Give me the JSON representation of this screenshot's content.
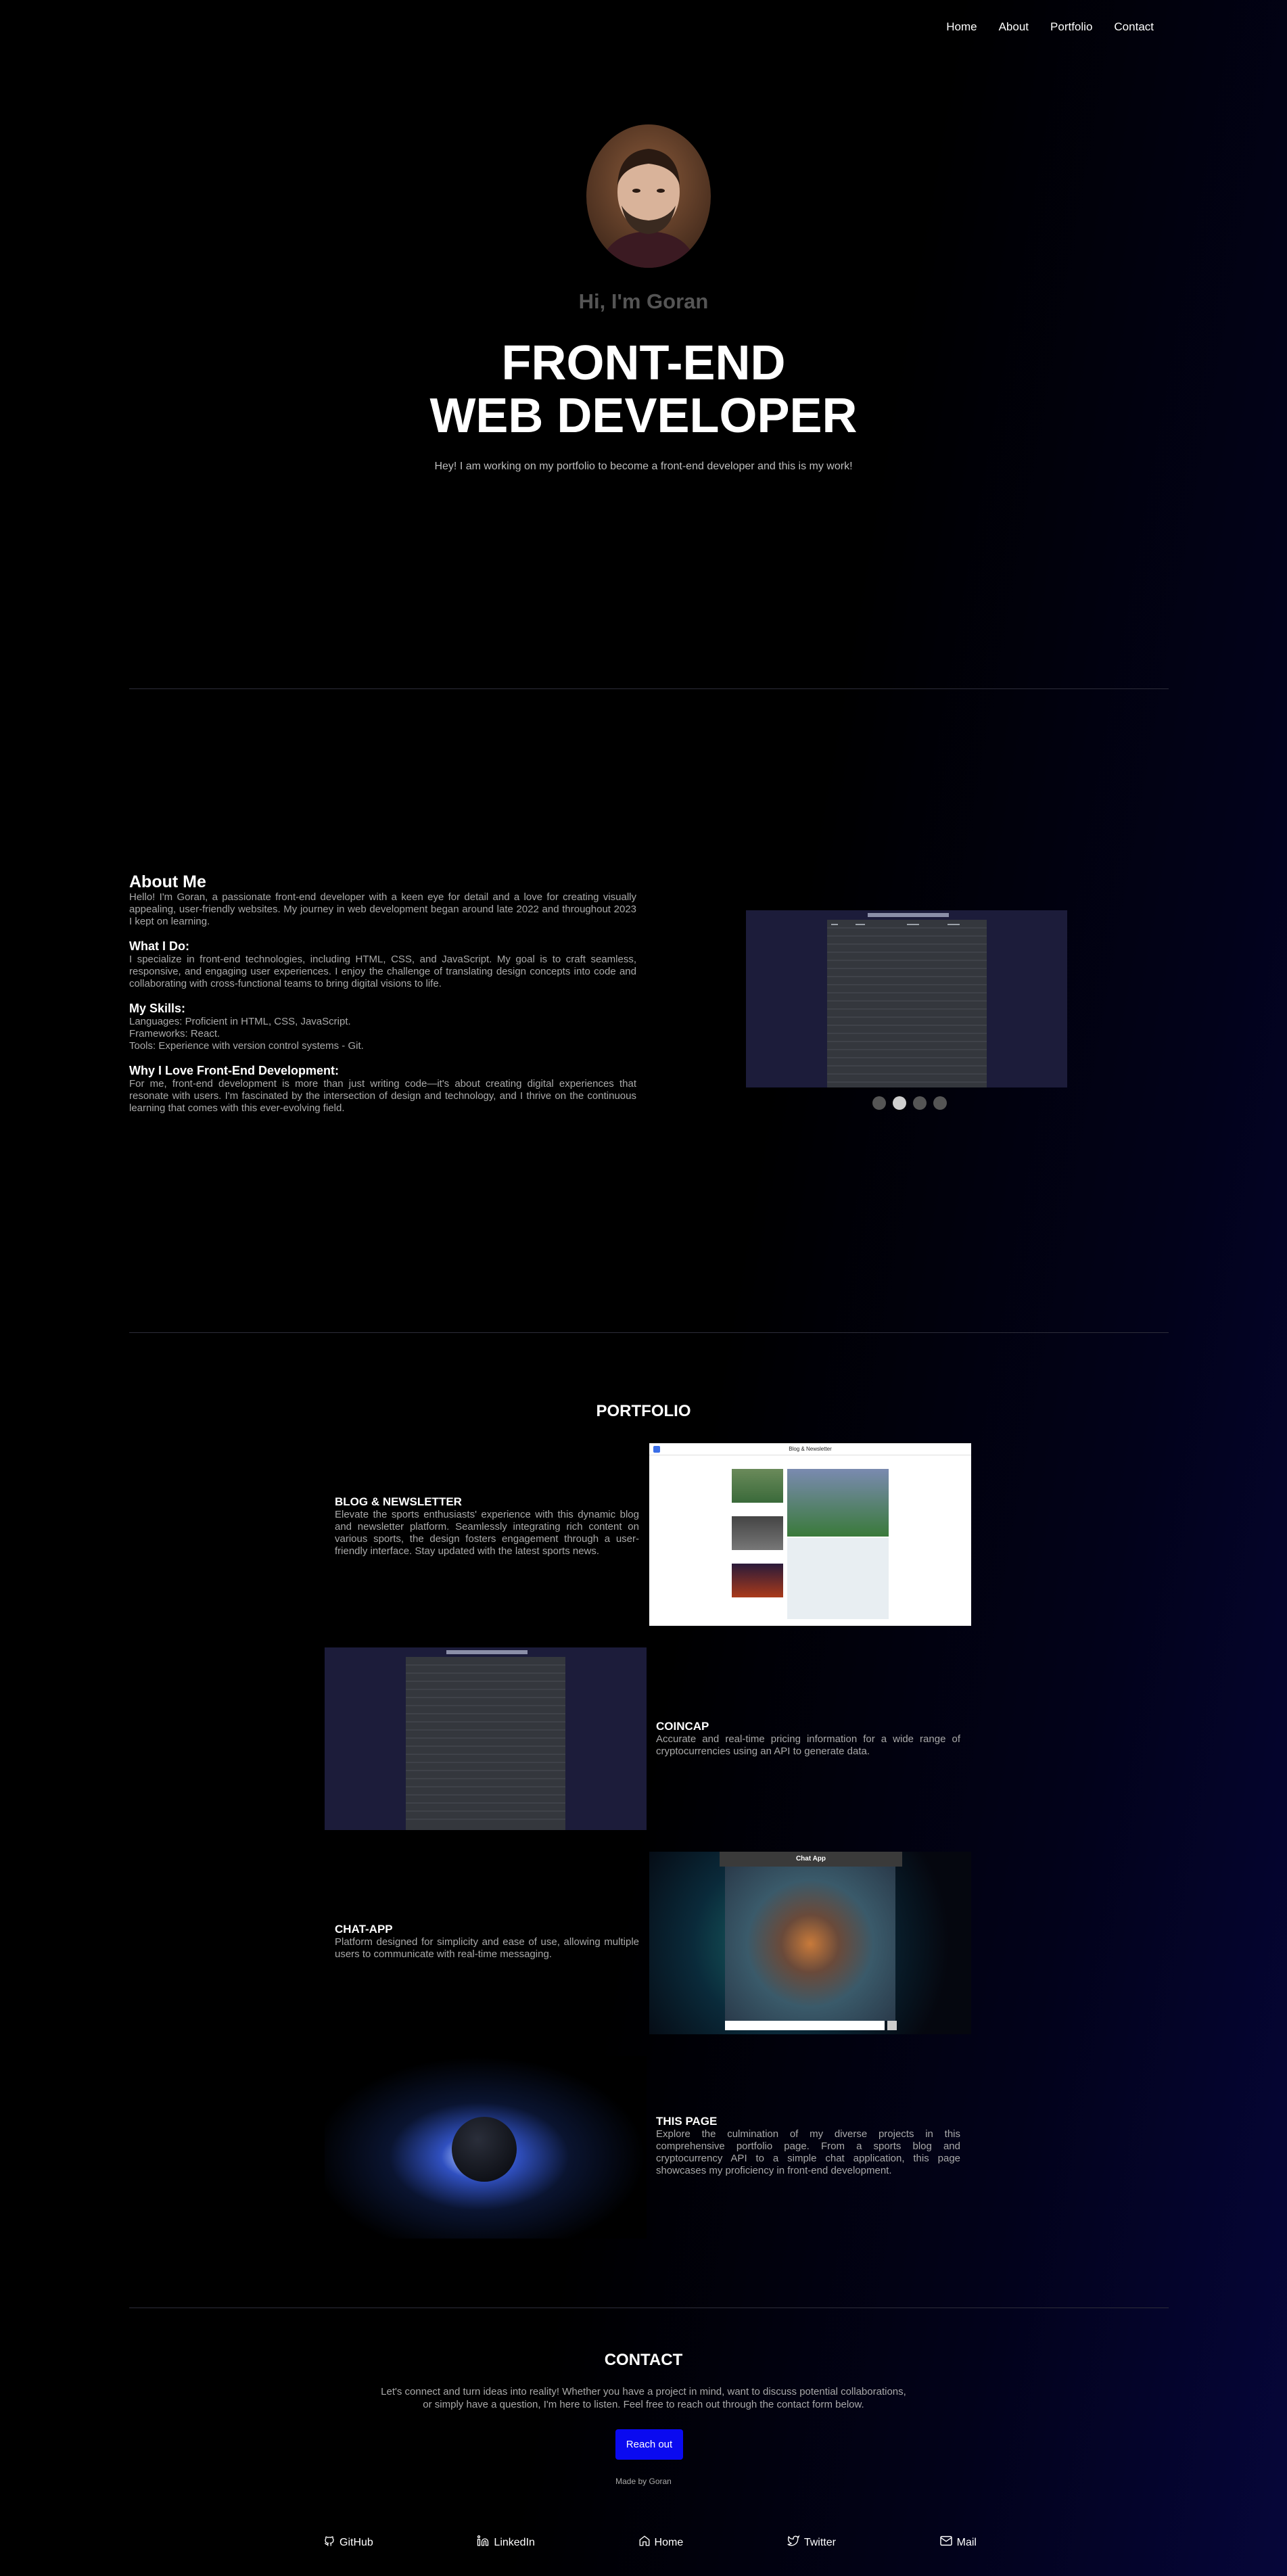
{
  "nav": [
    "Home",
    "About",
    "Portfolio",
    "Contact"
  ],
  "hero": {
    "greeting": "Hi, I'm Goran",
    "title_line1": "FRONT-END",
    "title_line2": "WEB DEVELOPER",
    "tagline": "Hey! I am working on my portfolio to become a front-end developer and this is my work!"
  },
  "about": {
    "heading": "About Me",
    "intro": "Hello! I'm Goran, a passionate front-end developer with a keen eye for detail and a love for creating visually appealing, user-friendly websites. My journey in web development began around late 2022 and throughout 2023 I kept on learning.",
    "what_heading": "What I Do:",
    "what_text": "I specialize in front-end technologies, including HTML, CSS, and JavaScript. My goal is to craft seamless, responsive, and engaging user experiences. I enjoy the challenge of translating design concepts into code and collaborating with cross-functional teams to bring digital visions to life.",
    "skills_heading": "My Skills:",
    "skills": [
      "Languages: Proficient in HTML, CSS, JavaScript.",
      "Frameworks: React.",
      "Tools: Experience with version control systems - Git."
    ],
    "why_heading": "Why I Love Front-End Development:",
    "why_text": "For me, front-end development is more than just writing code—it's about creating digital experiences that resonate with users. I'm fascinated by the intersection of design and technology, and I thrive on the continuous learning that comes with this ever-evolving field.",
    "carousel_active_index": 1,
    "carousel_count": 4
  },
  "portfolio": {
    "heading": "PORTFOLIO",
    "projects": [
      {
        "title": "BLOG & NEWSLETTER",
        "text": "Elevate the sports enthusiasts' experience with this dynamic blog and newsletter platform. Seamlessly integrating rich content on various sports, the design fosters engagement through a user-friendly interface. Stay updated with the latest sports news.",
        "image_label": "Blog & Newsletter"
      },
      {
        "title": "COINCAP",
        "text": "Accurate and real-time pricing information for a wide range of cryptocurrencies using an API to generate data."
      },
      {
        "title": "CHAT-APP",
        "text": "Platform designed for simplicity and ease of use, allowing multiple users to communicate with real-time messaging.",
        "image_label": "Chat App"
      },
      {
        "title": "THIS PAGE",
        "text": "Explore the culmination of my diverse projects in this comprehensive portfolio page. From a sports blog and cryptocurrency API to a simple chat application, this page showcases my proficiency in front-end development."
      }
    ]
  },
  "contact": {
    "heading": "CONTACT",
    "text_line1": "Let's connect and turn ideas into reality! Whether you have a project in mind, want to discuss potential collaborations,",
    "text_line2": "or simply have a question, I'm here to listen. Feel free to reach out through the contact form below.",
    "button": "Reach out",
    "made_by": "Made by Goran"
  },
  "footer": [
    {
      "label": "GitHub",
      "icon": "github-icon"
    },
    {
      "label": "LinkedIn",
      "icon": "linkedin-icon"
    },
    {
      "label": "Home",
      "icon": "home-icon"
    },
    {
      "label": "Twitter",
      "icon": "twitter-icon"
    },
    {
      "label": "Mail",
      "icon": "mail-icon"
    }
  ],
  "colors": {
    "accent": "#0a0af0",
    "muted_text": "#a9a9a9",
    "greeting": "#555555"
  }
}
